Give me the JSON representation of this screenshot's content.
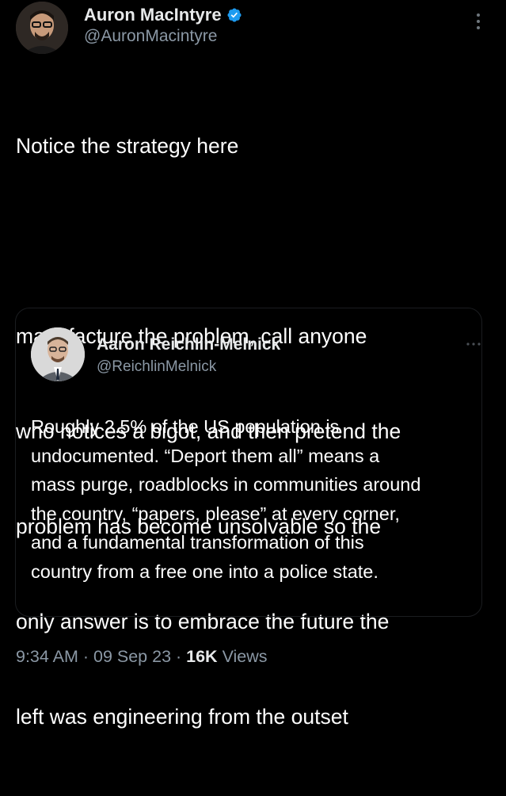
{
  "tweet": {
    "author": {
      "name": "Auron MacIntyre",
      "handle": "@AuronMacintyre",
      "verified": true
    },
    "text_lines": [
      "Notice the strategy here",
      "",
      "manufacture the problem, call anyone",
      "who notices a bigot, and then pretend the",
      "problem has become unsolvable so the",
      "only answer is to embrace the future the",
      "left was engineering from the outset"
    ],
    "quoted_tweet": {
      "author": {
        "name": "Aaron Reichlin-Melnick",
        "handle": "@ReichlinMelnick"
      },
      "text_lines": [
        "Roughly 2.5% of the US population is",
        "undocumented. “Deport them all” means a",
        "mass purge, roadblocks in communities around",
        "the country, “papers, please” at every corner,",
        "and a fundamental transformation of this",
        "country from a free one into a police state."
      ]
    },
    "meta": {
      "time": "9:34 AM",
      "separator": " · ",
      "date": "09 Sep 23",
      "views_count": "16K",
      "views_label": " Views"
    }
  },
  "colors": {
    "background": "#000000",
    "text": "#ffffff",
    "secondary_text": "#8b98a5",
    "verified_badge": "#1d9bf0"
  },
  "icons": {
    "verified": "verified-badge-icon",
    "more": "more-vertical-icon",
    "quote_more": "more-horizontal-icon"
  }
}
